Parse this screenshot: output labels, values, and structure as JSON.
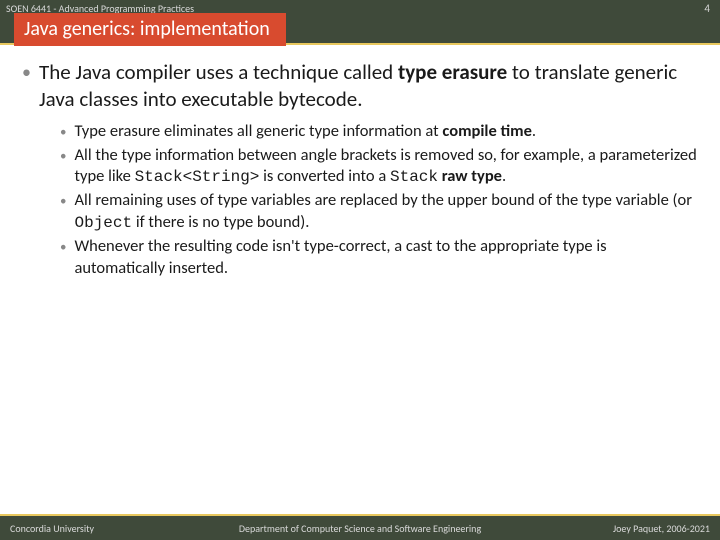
{
  "header": {
    "course": "SOEN 6441 - Advanced Programming Practices",
    "pageNumber": "4",
    "title": "Java generics: implementation"
  },
  "main": {
    "bullet": {
      "pre": "The Java compiler uses a technique called ",
      "bold": "type erasure",
      "post": " to translate generic Java classes into executable bytecode."
    }
  },
  "subs": {
    "s1": {
      "pre": "Type erasure eliminates all generic type information at ",
      "bold": "compile time",
      "post": "."
    },
    "s2": {
      "pre": "All the type information between angle brackets is removed so, for example, a parameterized type like ",
      "code1": "Stack<String>",
      "mid": " is converted into a ",
      "code2": "Stack",
      "bold": " raw type",
      "post": "."
    },
    "s3": {
      "pre": "All remaining uses of type variables are replaced by the upper bound of the type variable (or ",
      "code": "Object",
      "post": " if there is no type bound)."
    },
    "s4": {
      "text": "Whenever the resulting code isn't type-correct, a cast to the appropriate type is automatically inserted."
    }
  },
  "footer": {
    "left": "Concordia University",
    "center": "Department of Computer Science and Software Engineering",
    "right": "Joey Paquet, 2006-2021"
  }
}
